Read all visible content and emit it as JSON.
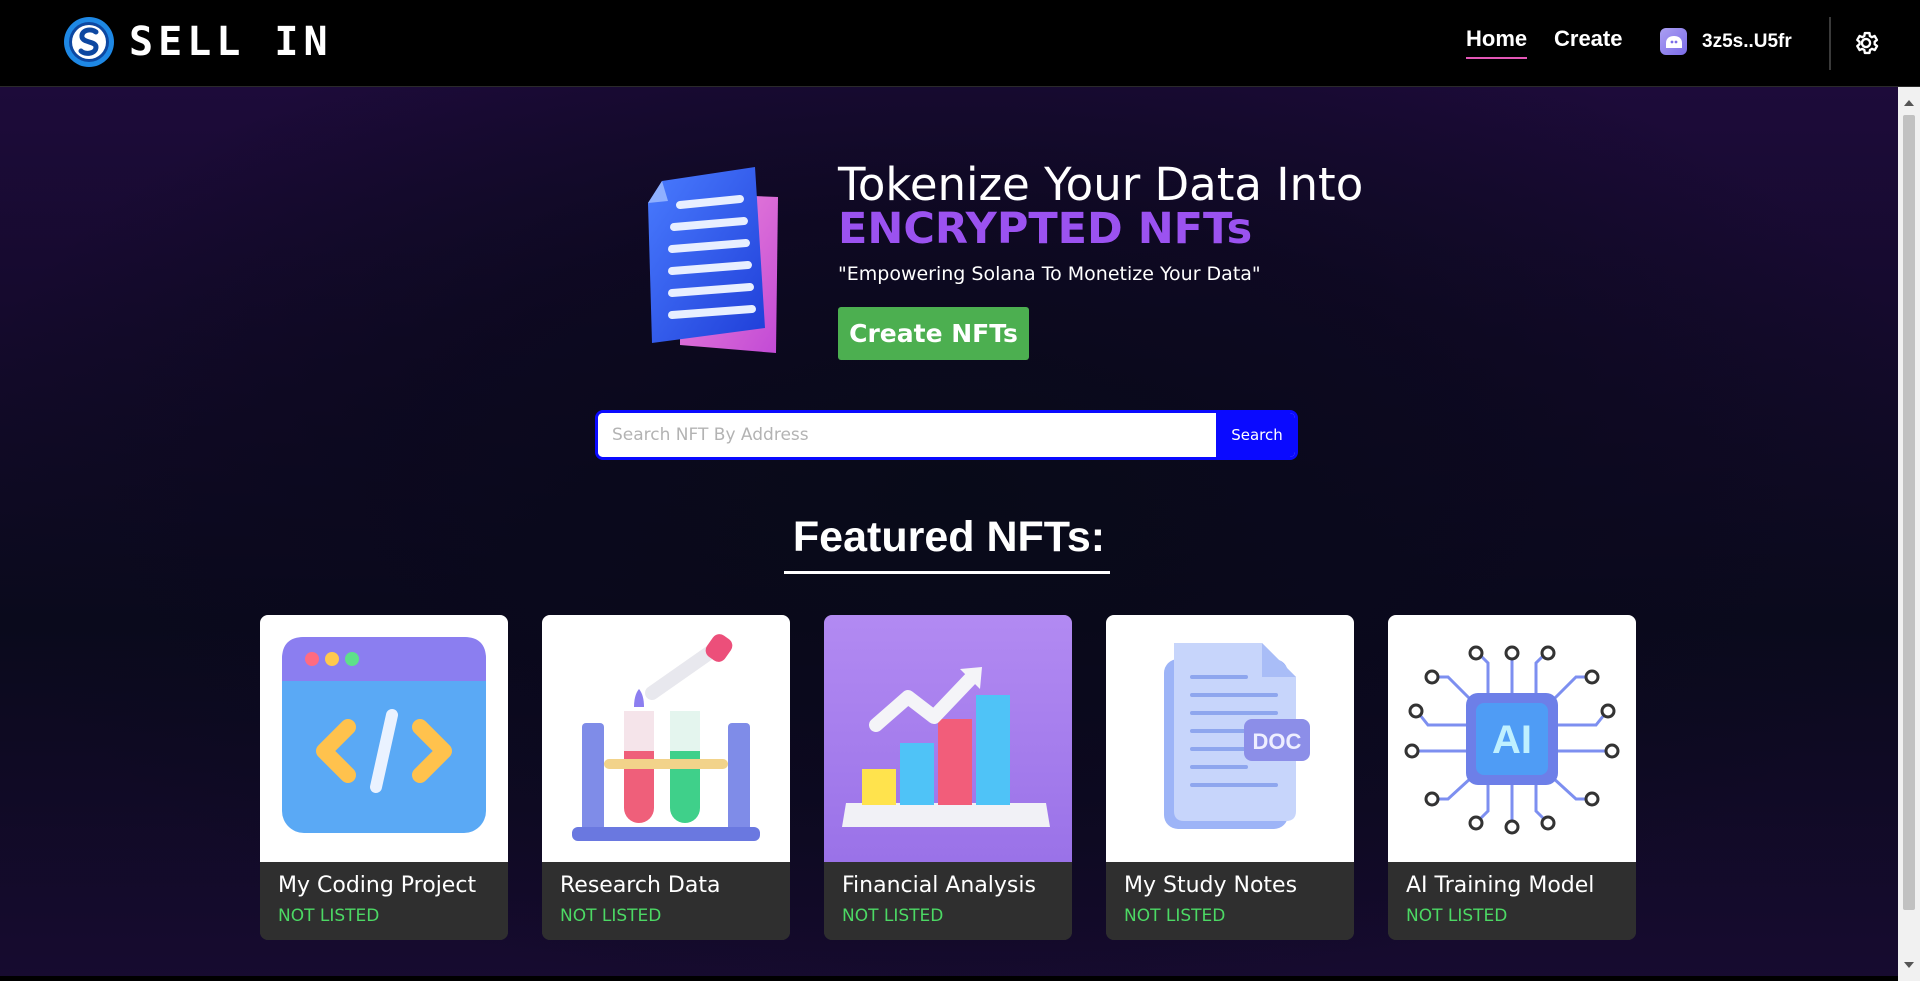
{
  "header": {
    "brand": "SELL IN",
    "nav": {
      "home": "Home",
      "create": "Create"
    },
    "wallet_address": "3z5s..U5fr"
  },
  "hero": {
    "title_line1": "Tokenize Your Data Into",
    "title_line2": "ENCRYPTED NFTs",
    "subtitle": "\"Empowering Solana To Monetize Your Data\"",
    "cta_label": "Create NFTs"
  },
  "search": {
    "placeholder": "Search NFT By Address",
    "value": "",
    "button_label": "Search"
  },
  "featured": {
    "title": "Featured NFTs:",
    "cards": [
      {
        "name": "My Coding Project",
        "status": "NOT LISTED",
        "image": "code-window-icon"
      },
      {
        "name": "Research Data",
        "status": "NOT LISTED",
        "image": "test-tubes-icon"
      },
      {
        "name": "Financial Analysis",
        "status": "NOT LISTED",
        "image": "bar-chart-icon"
      },
      {
        "name": "My Study Notes",
        "status": "NOT LISTED",
        "image": "doc-file-icon"
      },
      {
        "name": "AI Training Model",
        "status": "NOT LISTED",
        "image": "ai-chip-icon"
      }
    ]
  },
  "colors": {
    "accent_purple": "#9b52f0",
    "cta_green": "#4caf50",
    "search_blue": "#0a0aff",
    "status_green": "#4cd964",
    "nav_underline": "#e457b7"
  },
  "card_image_url": "",
  "doc_label": "DOC",
  "ai_label": "AI"
}
